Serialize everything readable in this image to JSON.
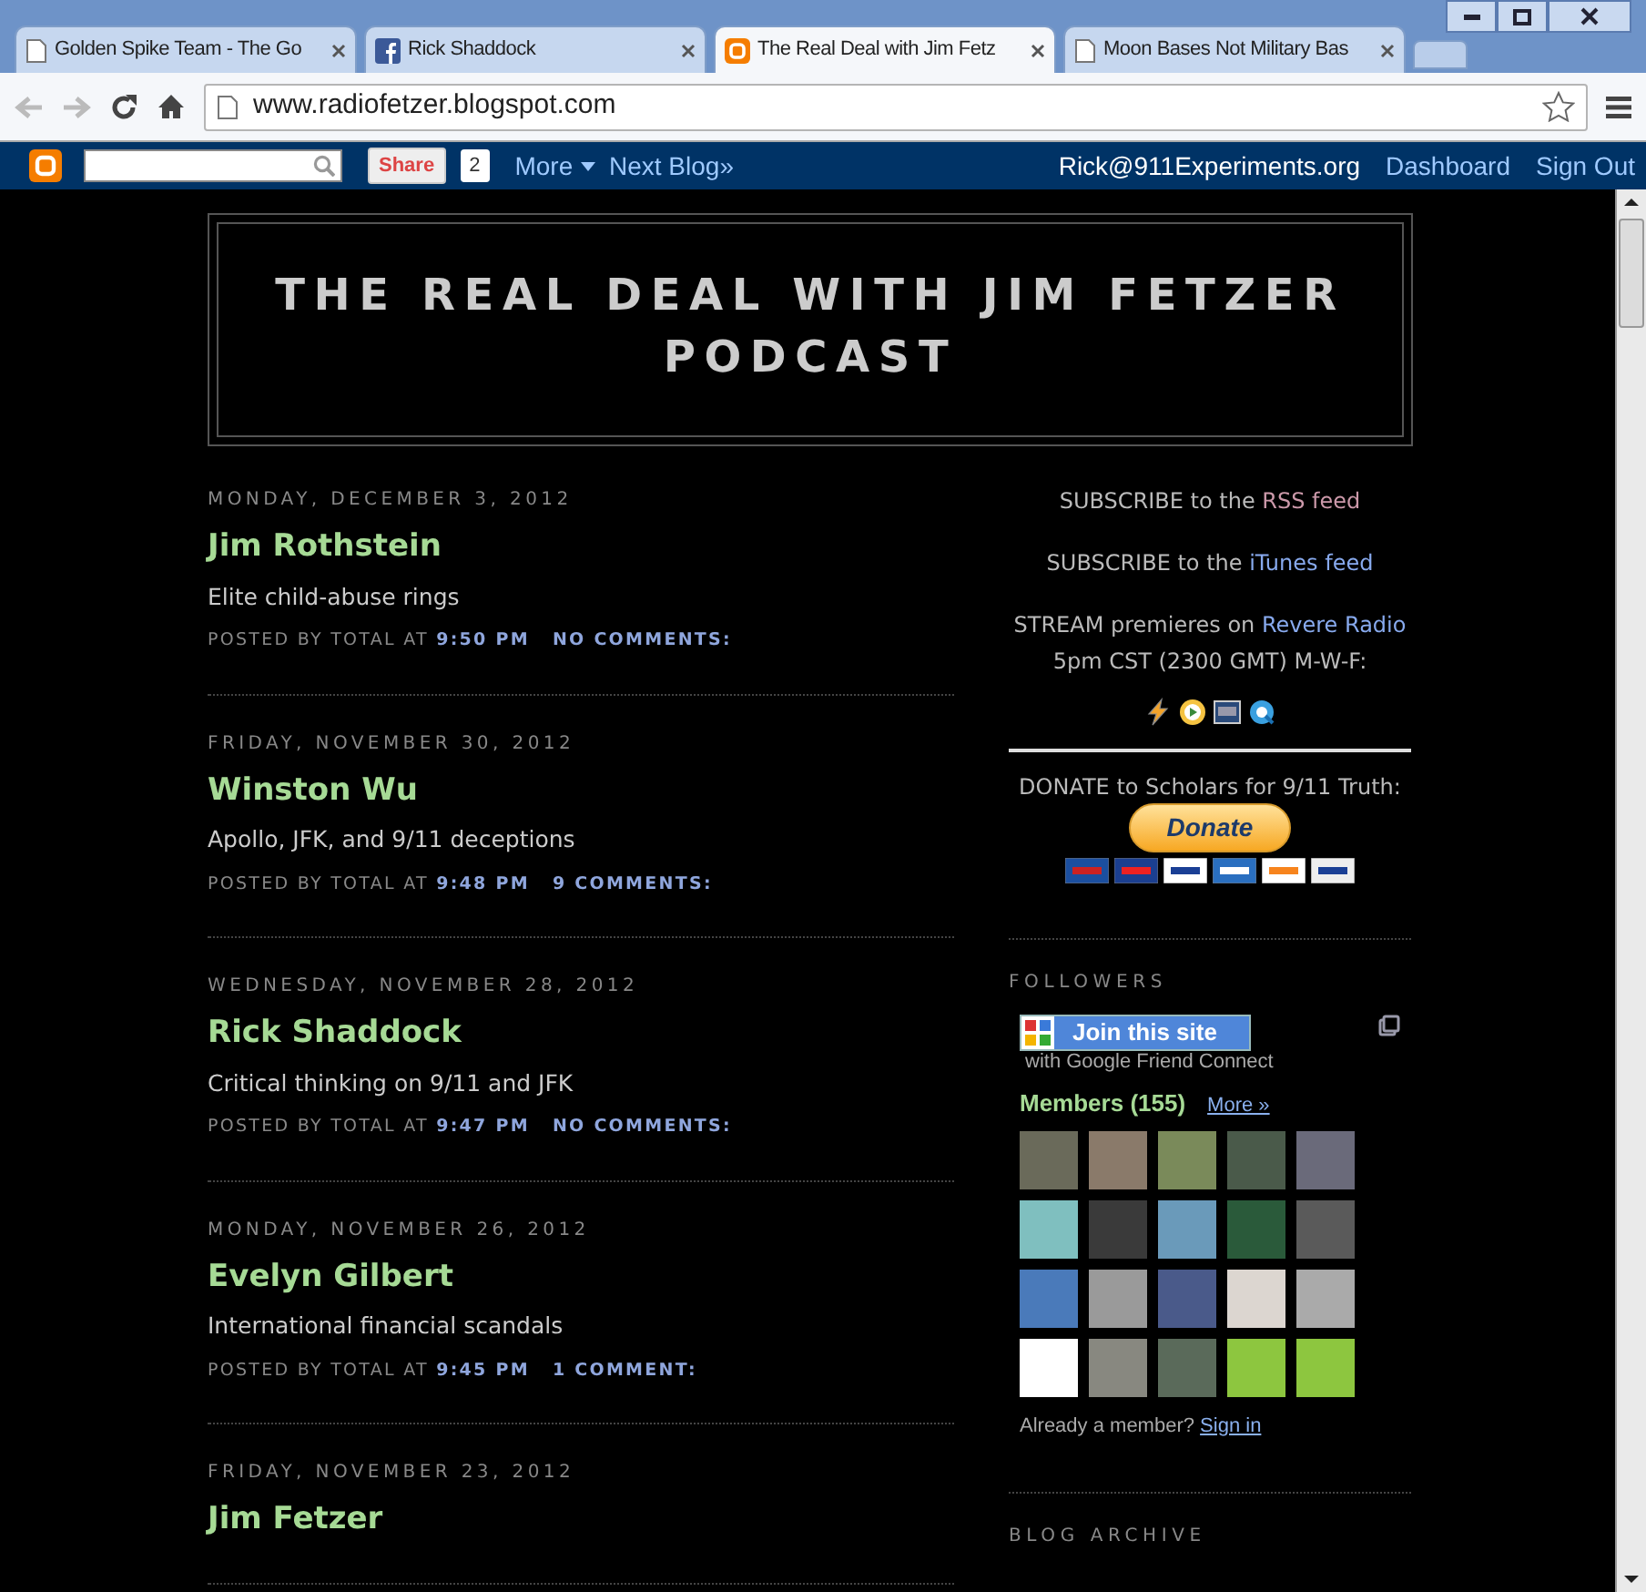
{
  "tabs": [
    {
      "kind": "page",
      "title": "Golden Spike Team - The Go",
      "selected": false
    },
    {
      "kind": "facebook",
      "title": "Rick Shaddock",
      "selected": false
    },
    {
      "kind": "blogger",
      "title": "The Real Deal with Jim Fetz",
      "selected": true
    },
    {
      "kind": "page",
      "title": "Moon Bases Not Military Bas",
      "selected": false
    }
  ],
  "address_bar": {
    "url": "www.radiofetzer.blogspot.com"
  },
  "blogger_bar": {
    "share": "Share",
    "share_count": "2",
    "more": "More",
    "next_blog": "Next Blog»",
    "user": "Rick@911Experiments.org",
    "dashboard": "Dashboard",
    "sign_out": "Sign Out"
  },
  "header": {
    "title": "THE REAL DEAL WITH JIM FETZER PODCAST"
  },
  "posts": [
    {
      "date": "MONDAY, DECEMBER 3, 2012",
      "title": "Jim Rothstein",
      "summary": "Elite child-abuse rings",
      "posted_by": "POSTED BY TOTAL AT",
      "time": "9:50 PM",
      "comments": "NO COMMENTS:"
    },
    {
      "date": "FRIDAY, NOVEMBER 30, 2012",
      "title": "Winston Wu",
      "summary": "Apollo, JFK, and 9/11 deceptions",
      "posted_by": "POSTED BY TOTAL AT",
      "time": "9:48 PM",
      "comments": "9 COMMENTS:"
    },
    {
      "date": "WEDNESDAY, NOVEMBER 28, 2012",
      "title": "Rick Shaddock",
      "summary": "Critical thinking on 9/11 and JFK",
      "posted_by": "POSTED BY TOTAL AT",
      "time": "9:47 PM",
      "comments": "NO COMMENTS:"
    },
    {
      "date": "MONDAY, NOVEMBER 26, 2012",
      "title": "Evelyn Gilbert",
      "summary": "International financial scandals",
      "posted_by": "POSTED BY TOTAL AT",
      "time": "9:45 PM",
      "comments": "1 COMMENT:"
    },
    {
      "date": "FRIDAY, NOVEMBER 23, 2012",
      "title": "Jim Fetzer"
    }
  ],
  "sidebar": {
    "links": [
      {
        "text": "SUBSCRIBE to the",
        "link": "RSS feed",
        "visited": true
      },
      {
        "text": "SUBSCRIBE to the",
        "link": "iTunes feed",
        "visited": false
      },
      {
        "text": "STREAM premieres on",
        "link": "Revere Radio",
        "visited": false,
        "after": "5pm CST (2300 GMT) M-W-F:"
      }
    ],
    "donate": {
      "text": "DONATE to Scholars for 9/11 Truth:",
      "button": "Donate"
    },
    "followers": {
      "heading": "FOLLOWERS",
      "join": "Join this site",
      "join_sub": "with Google Friend Connect",
      "members": "Members (155)",
      "more": "More »",
      "already": "Already a member?",
      "sign_in": "Sign in"
    },
    "archive_heading": "BLOG ARCHIVE"
  }
}
